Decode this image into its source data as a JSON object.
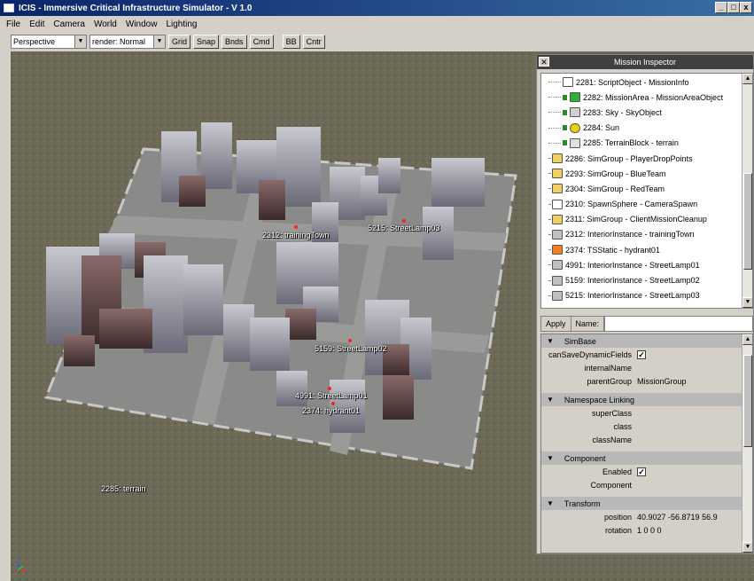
{
  "window": {
    "title": "ICIS - Immersive Critical Infrastructure Simulator - V 1.0",
    "buttons": [
      "_",
      "□",
      "x"
    ]
  },
  "menu": [
    "File",
    "Edit",
    "Camera",
    "World",
    "Window",
    "Lighting"
  ],
  "toolbar": {
    "camera_select": "Perspective",
    "render_select": "render: Normal",
    "buttons": [
      "Grid",
      "Snap",
      "Bnds",
      "Cmd",
      "BB",
      "Cntr"
    ]
  },
  "viewport": {
    "labels": {
      "training_town": "2312: trainingTown",
      "streetlamp03": "5215: StreetLamp03",
      "streetlamp02": "5159: StreetLamp02",
      "streetlamp01": "4991: StreetLamp01",
      "hydrant": "2374: hydrant01",
      "terrain": "2285: terrain"
    }
  },
  "inspector": {
    "title": "Mission Inspector",
    "tree": [
      {
        "label": "2281: ScriptObject - MissionInfo",
        "icon": "script-icon",
        "color": "#ffffff"
      },
      {
        "label": "2282: MissionArea - MissionAreaObject",
        "icon": "mission-area-icon",
        "color": "#30b030"
      },
      {
        "label": "2283: Sky - SkyObject",
        "icon": "sky-icon",
        "color": "#d0d0d0"
      },
      {
        "label": "2284: Sun",
        "icon": "sun-icon",
        "color": "#f0d000"
      },
      {
        "label": "2285: TerrainBlock - terrain",
        "icon": "terrain-icon",
        "color": "#e0e0e0"
      },
      {
        "label": "2286: SimGroup - PlayerDropPoints",
        "icon": "folder-icon",
        "color": "#f0d060"
      },
      {
        "label": "2293: SimGroup - BlueTeam",
        "icon": "folder-icon",
        "color": "#f0d060"
      },
      {
        "label": "2304: SimGroup - RedTeam",
        "icon": "folder-icon",
        "color": "#f0d060"
      },
      {
        "label": "2310: SpawnSphere - CameraSpawn",
        "icon": "spawn-icon",
        "color": "#ffffff"
      },
      {
        "label": "2311: SimGroup - ClientMissionCleanup",
        "icon": "folder-icon",
        "color": "#f0d060"
      },
      {
        "label": "2312: InteriorInstance - trainingTown",
        "icon": "interior-icon",
        "color": "#c0c0c0"
      },
      {
        "label": "2374: TSStatic - hydrant01",
        "icon": "static-icon",
        "color": "#f08020"
      },
      {
        "label": "4991: InteriorInstance - StreetLamp01",
        "icon": "interior-icon",
        "color": "#c0c0c0"
      },
      {
        "label": "5159: InteriorInstance - StreetLamp02",
        "icon": "interior-icon",
        "color": "#c0c0c0"
      },
      {
        "label": "5215: InteriorInstance - StreetLamp03",
        "icon": "interior-icon",
        "color": "#c0c0c0"
      }
    ],
    "apply_label": "Apply",
    "name_label": "Name:",
    "name_value": "",
    "groups": [
      {
        "title": "SimBase",
        "rows": [
          {
            "label": "canSaveDynamicFields",
            "value": "",
            "checkbox": true,
            "checked": true
          },
          {
            "label": "internalName",
            "value": "",
            "checkbox": false,
            "checked": false
          },
          {
            "label": "parentGroup",
            "value": "MissionGroup",
            "checkbox": false,
            "checked": false
          }
        ]
      },
      {
        "title": "Namespace Linking",
        "rows": [
          {
            "label": "superClass",
            "value": "",
            "checkbox": false,
            "checked": false
          },
          {
            "label": "class",
            "value": "",
            "checkbox": false,
            "checked": false
          },
          {
            "label": "className",
            "value": "",
            "checkbox": false,
            "checked": false
          }
        ]
      },
      {
        "title": "Component",
        "rows": [
          {
            "label": "Enabled",
            "value": "",
            "checkbox": true,
            "checked": true
          },
          {
            "label": "Component",
            "value": "",
            "checkbox": false,
            "checked": false
          }
        ]
      },
      {
        "title": "Transform",
        "rows": [
          {
            "label": "position",
            "value": "40.9027 -56.8719 56.9",
            "checkbox": false,
            "checked": false
          },
          {
            "label": "rotation",
            "value": "1 0 0 0",
            "checkbox": false,
            "checked": false
          }
        ]
      }
    ],
    "tree_scroll_fraction": 0.75,
    "props_scroll_fraction": 0.3
  }
}
